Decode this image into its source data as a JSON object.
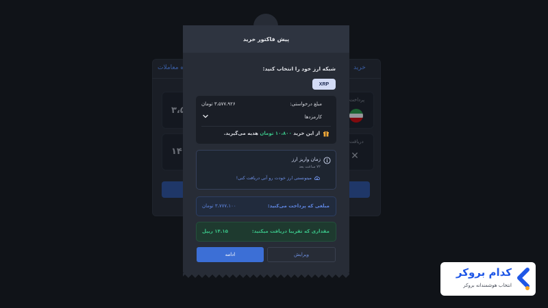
{
  "background": {
    "tab_right": "خرید",
    "tab_left": "ه معاملات",
    "pay_label": "پرداخت",
    "receive_label": "دریافت",
    "amount_top": "۳،۵",
    "amount_bottom": "۱۴.۱"
  },
  "modal": {
    "title": "پیش فاکتور خرید",
    "select_label": "شبکه ارز خود را انتخاب کنید:",
    "network_chip": "XRP",
    "requested_label": "مبلغ درخواستی:",
    "requested_value": "۳،۵۷۷،۹۲۶ تومان",
    "fees_label": "کارمزدها",
    "gift_text_before": "از این خرید ",
    "gift_amount": "۱۰،۸۰۰ تومان",
    "gift_text_after": " هدیه می‌گیرید.",
    "deposit_title": "زمان واریز ارز",
    "deposit_time": "۷۲ ساعت بعد",
    "deposit_link": "میتونستی ارز خودت رو آنی دریافت کنی!",
    "pay_label": "مبلغی که پرداخت می‌کنید:",
    "pay_value": "۳،۷۷۷،۱۰۰ تومان",
    "receive_label": "مقداری که تقریبا دریافت میکنید:",
    "receive_value": "۱۴.۱۵ ریپل",
    "continue_button": "ادامه",
    "edit_button": "ویرایش"
  },
  "logo": {
    "name": "کدام بروکر",
    "tagline": "انتخاب هوشمندانه بروکر"
  },
  "colors": {
    "accent": "#3c6fd6",
    "success": "#3ac287",
    "modal_bg": "#272c36",
    "page_bg": "#101318"
  }
}
